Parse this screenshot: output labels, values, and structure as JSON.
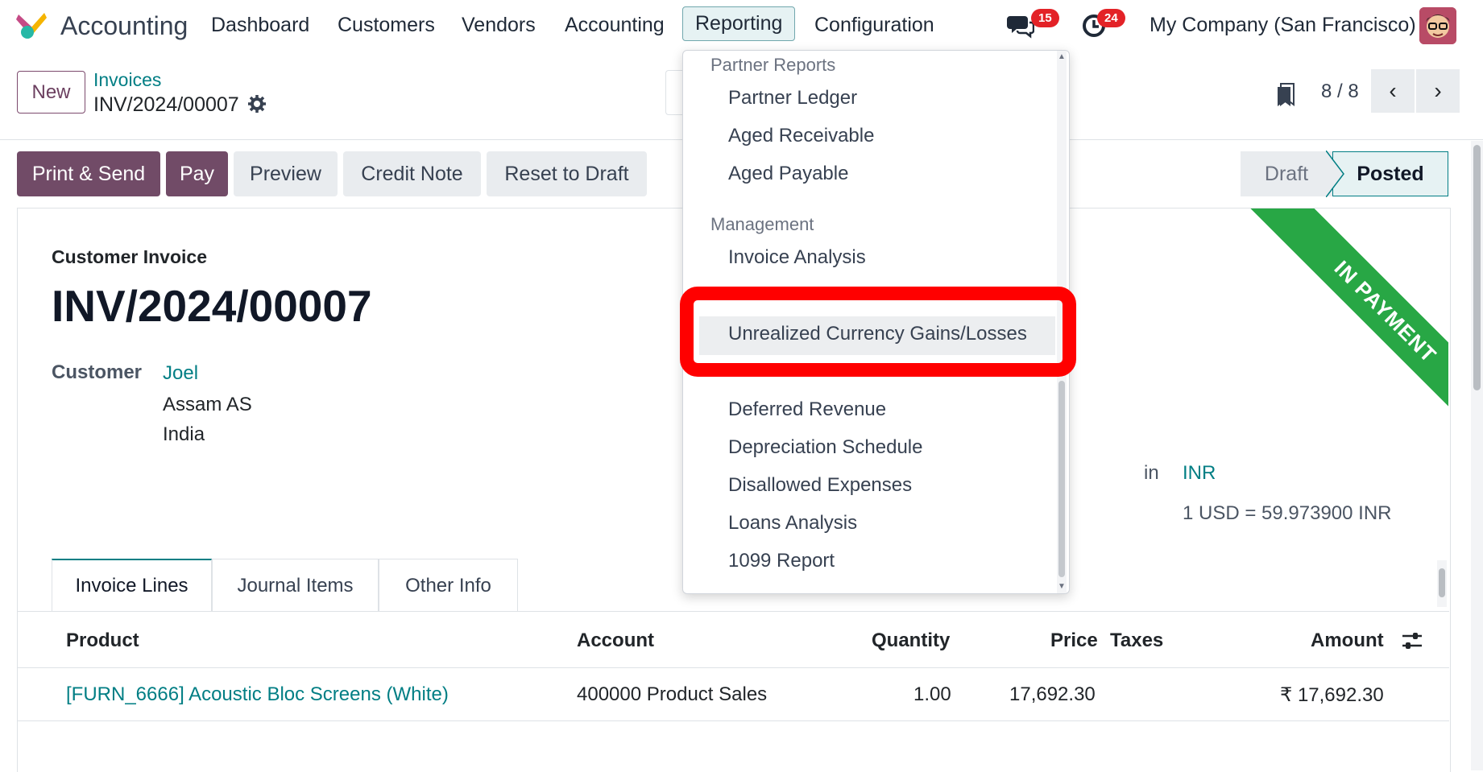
{
  "app": {
    "title": "Accounting",
    "logo_icon": "odoo-accounting-logo"
  },
  "nav": {
    "items": [
      "Dashboard",
      "Customers",
      "Vendors",
      "Accounting",
      "Reporting",
      "Configuration"
    ],
    "active": "Reporting",
    "messages_count": "15",
    "activities_count": "24",
    "company": "My Company (San Francisco)"
  },
  "control": {
    "new_label": "New",
    "breadcrumb_parent": "Invoices",
    "breadcrumb_current": "INV/2024/00007",
    "pager": "8 / 8"
  },
  "actions": {
    "print_send": "Print & Send",
    "pay": "Pay",
    "preview": "Preview",
    "credit_note": "Credit Note",
    "reset_draft": "Reset to Draft"
  },
  "status": {
    "draft": "Draft",
    "posted": "Posted"
  },
  "ribbon": "IN PAYMENT",
  "invoice": {
    "type_label": "Customer Invoice",
    "number": "INV/2024/00007",
    "customer_label": "Customer",
    "customer_name": "Joel",
    "customer_address_1": "Assam AS",
    "customer_address_2": "India",
    "currency_prefix": "in",
    "currency": "INR",
    "rate": "1 USD = 59.973900 INR"
  },
  "tabs": [
    "Invoice Lines",
    "Journal Items",
    "Other Info"
  ],
  "table": {
    "headers": {
      "product": "Product",
      "account": "Account",
      "quantity": "Quantity",
      "price": "Price",
      "taxes": "Taxes",
      "amount": "Amount"
    },
    "rows": [
      {
        "product": "[FURN_6666] Acoustic Bloc Screens (White)",
        "account": "400000 Product Sales",
        "quantity": "1.00",
        "price": "17,692.30",
        "taxes": "",
        "amount": "₹ 17,692.30"
      }
    ]
  },
  "reporting_menu": {
    "section_partner": "Partner Reports",
    "partner_items": [
      "Partner Ledger",
      "Aged Receivable",
      "Aged Payable"
    ],
    "section_management": "Management",
    "management_items": [
      "Invoice Analysis",
      "Unrealized Currency Gains/Losses",
      "Deferred Revenue",
      "Depreciation Schedule",
      "Disallowed Expenses",
      "Loans Analysis",
      "1099 Report"
    ],
    "highlighted": "Unrealized Currency Gains/Losses"
  },
  "colors": {
    "brand": "#714b67",
    "link": "#017e84",
    "ribbon": "#28a745",
    "highlight": "#ff0000",
    "badge": "#e32227"
  }
}
